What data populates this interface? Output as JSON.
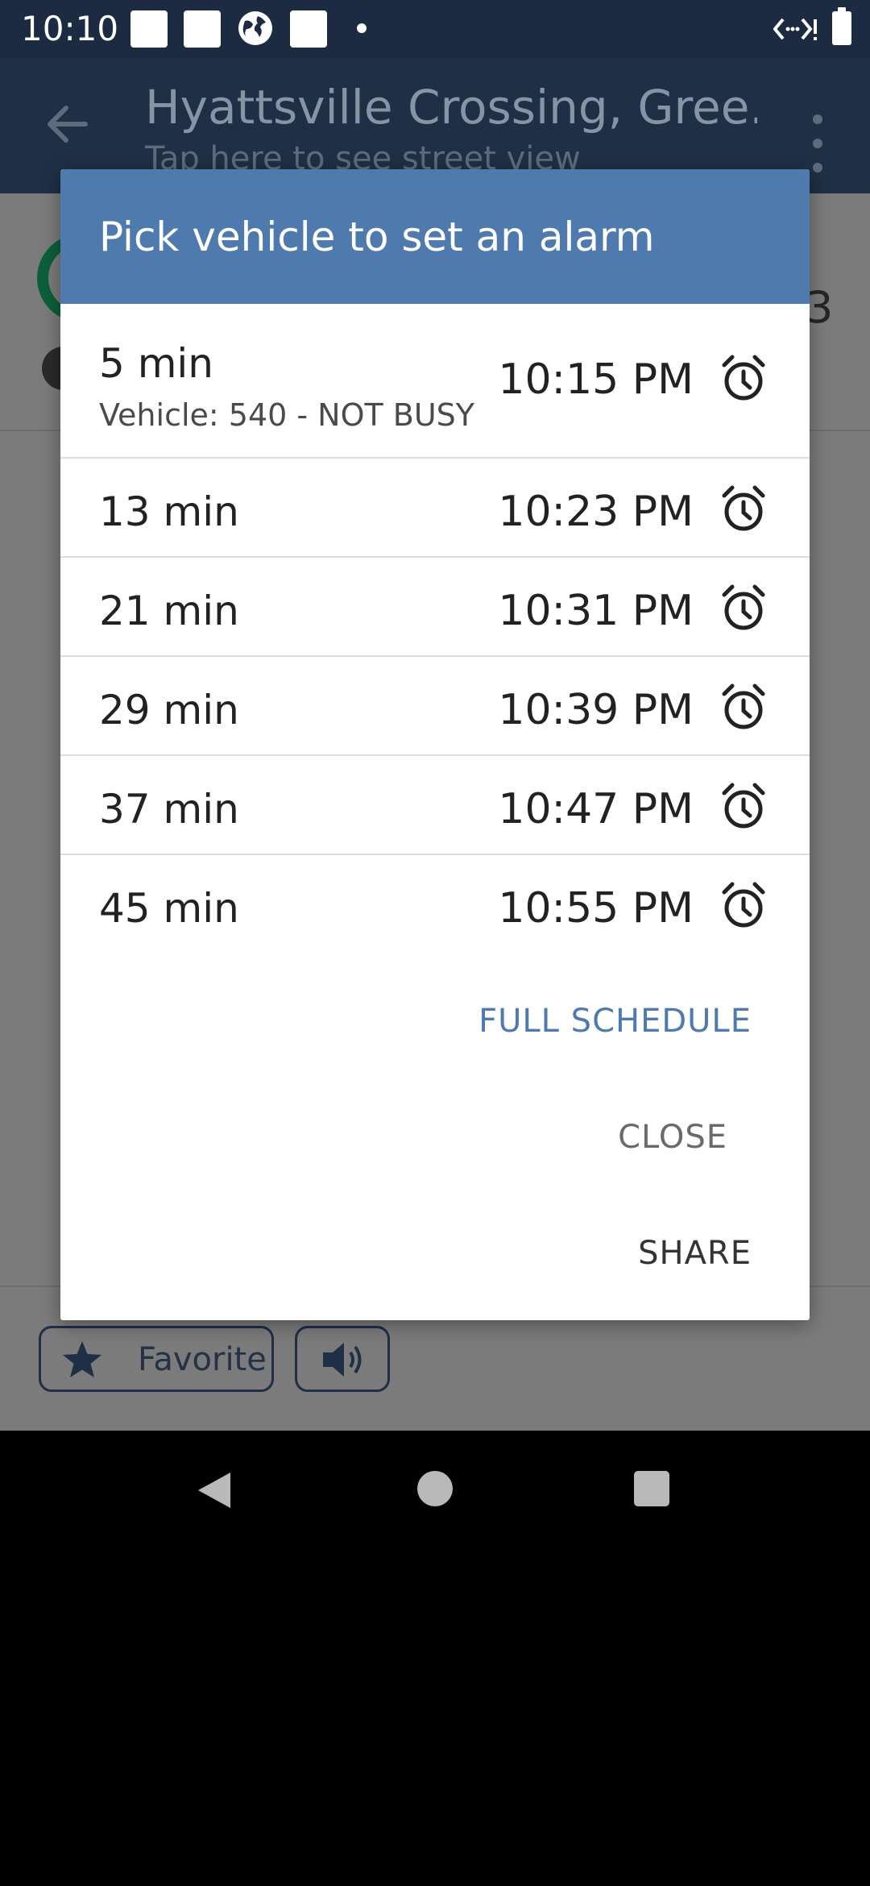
{
  "status_bar": {
    "time": "10:10"
  },
  "app_bar": {
    "title": "Hyattsville Crossing, Gree...",
    "subtitle": "Tap here to see street view"
  },
  "background": {
    "route_number": "3",
    "favorite_label": "Favorite"
  },
  "dialog": {
    "title": "Pick vehicle to set an alarm",
    "rows": [
      {
        "minutes": "5 min",
        "vehicle": "Vehicle: 540 - NOT BUSY",
        "time": "10:15 PM"
      },
      {
        "minutes": "13 min",
        "time": "10:23 PM"
      },
      {
        "minutes": "21 min",
        "time": "10:31 PM"
      },
      {
        "minutes": "29 min",
        "time": "10:39 PM"
      },
      {
        "minutes": "37 min",
        "time": "10:47 PM"
      },
      {
        "minutes": "45 min",
        "time": "10:55 PM"
      }
    ],
    "full_schedule_label": "FULL SCHEDULE",
    "close_label": "CLOSE",
    "share_label": "SHARE"
  },
  "colors": {
    "header_blue": "#4f7aad",
    "app_bar_dark": "#1c2b41",
    "scrim_gray": "#7b7b7b"
  }
}
